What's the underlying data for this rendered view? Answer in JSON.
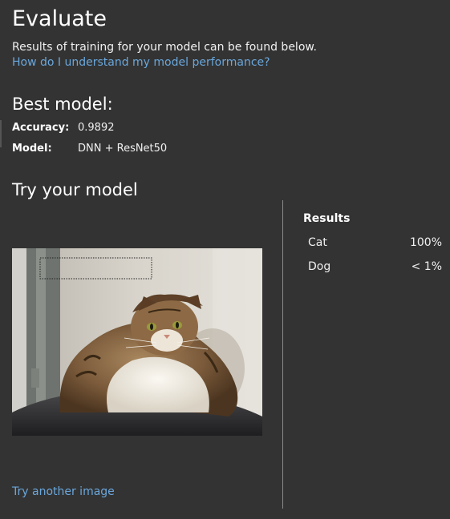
{
  "header": {
    "title": "Evaluate",
    "subtitle": "Results of training for your model can be found below.",
    "help_link": "How do I understand my model performance?"
  },
  "best_model": {
    "heading": "Best model:",
    "accuracy_label": "Accuracy:",
    "accuracy_value": "0.9892",
    "model_label": "Model:",
    "model_value": "DNN + ResNet50"
  },
  "try_model": {
    "heading": "Try your model",
    "image_subject": "cat-photo",
    "try_another": "Try another image"
  },
  "results": {
    "title": "Results",
    "rows": [
      {
        "label": "Cat",
        "value": "100%"
      },
      {
        "label": "Dog",
        "value": "< 1%"
      }
    ]
  },
  "colors": {
    "background": "#333333",
    "link": "#6aa7dc",
    "text": "#f0f0f0"
  }
}
